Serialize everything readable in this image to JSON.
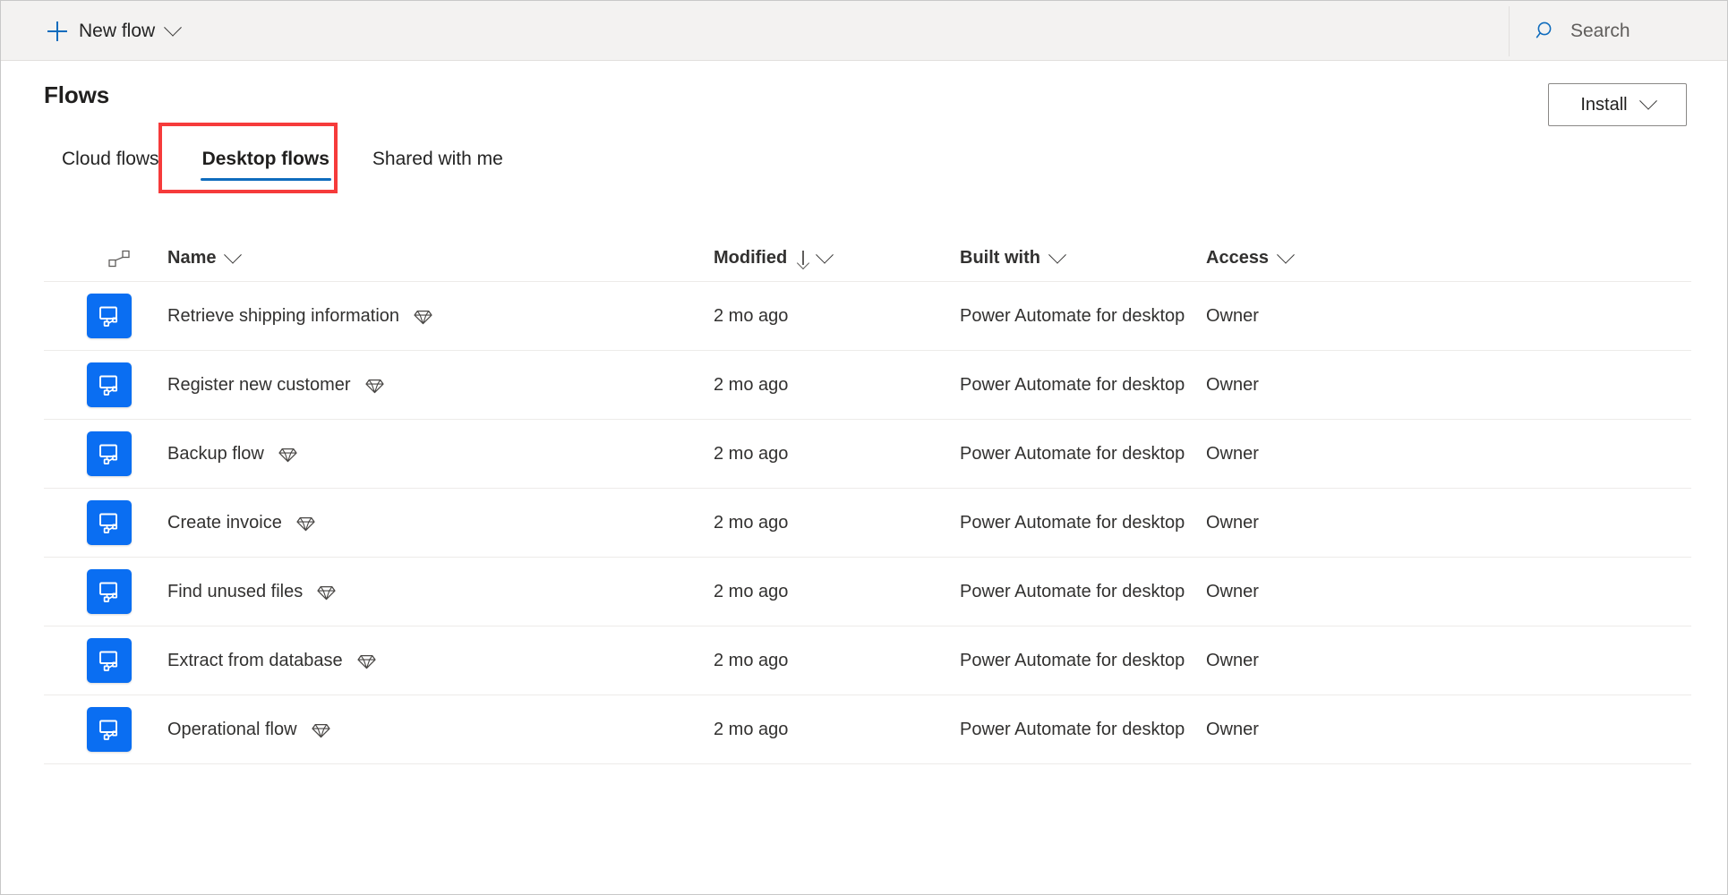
{
  "topbar": {
    "new_flow_label": "New flow",
    "new_flow_icon": "plus-icon",
    "new_flow_chevron": "chevron-down-icon",
    "search_placeholder": "Search",
    "search_icon": "search-icon",
    "accent_color": "#0f6cbd",
    "background_color": "#f3f2f1"
  },
  "header": {
    "title": "Flows",
    "install_label": "Install",
    "install_chevron": "chevron-down-icon"
  },
  "tabs": [
    {
      "label": "Cloud flows",
      "selected": false
    },
    {
      "label": "Desktop flows",
      "selected": true
    },
    {
      "label": "Shared with me",
      "selected": false
    }
  ],
  "annotation": {
    "target": "Desktop flows",
    "color": "#f63b3b",
    "shape": "rectangle-outline"
  },
  "table": {
    "columns": [
      {
        "key": "icon",
        "label": "",
        "icon": "flow-connector-icon",
        "sortable": true
      },
      {
        "key": "name",
        "label": "Name",
        "sortable": true
      },
      {
        "key": "modified",
        "label": "Modified",
        "sortable": true,
        "sort_direction": "descending"
      },
      {
        "key": "built_with",
        "label": "Built with",
        "sortable": true
      },
      {
        "key": "access",
        "label": "Access",
        "sortable": true
      }
    ],
    "rows": [
      {
        "icon": "desktop-flow-icon",
        "name": "Retrieve shipping information",
        "premium": true,
        "modified": "2 mo ago",
        "built_with": "Power Automate for desktop",
        "access": "Owner"
      },
      {
        "icon": "desktop-flow-icon",
        "name": "Register new customer",
        "premium": true,
        "modified": "2 mo ago",
        "built_with": "Power Automate for desktop",
        "access": "Owner"
      },
      {
        "icon": "desktop-flow-icon",
        "name": "Backup flow",
        "premium": true,
        "modified": "2 mo ago",
        "built_with": "Power Automate for desktop",
        "access": "Owner"
      },
      {
        "icon": "desktop-flow-icon",
        "name": "Create invoice",
        "premium": true,
        "modified": "2 mo ago",
        "built_with": "Power Automate for desktop",
        "access": "Owner"
      },
      {
        "icon": "desktop-flow-icon",
        "name": "Find unused files",
        "premium": true,
        "modified": "2 mo ago",
        "built_with": "Power Automate for desktop",
        "access": "Owner"
      },
      {
        "icon": "desktop-flow-icon",
        "name": "Extract from database",
        "premium": true,
        "modified": "2 mo ago",
        "built_with": "Power Automate for desktop",
        "access": "Owner"
      },
      {
        "icon": "desktop-flow-icon",
        "name": "Operational flow",
        "premium": true,
        "modified": "2 mo ago",
        "built_with": "Power Automate for desktop",
        "access": "Owner"
      }
    ]
  },
  "colors": {
    "tile_blue": "#0a6ef2",
    "link_blue": "#0f6cbd",
    "text_primary": "#323130",
    "divider": "#edebe9"
  }
}
